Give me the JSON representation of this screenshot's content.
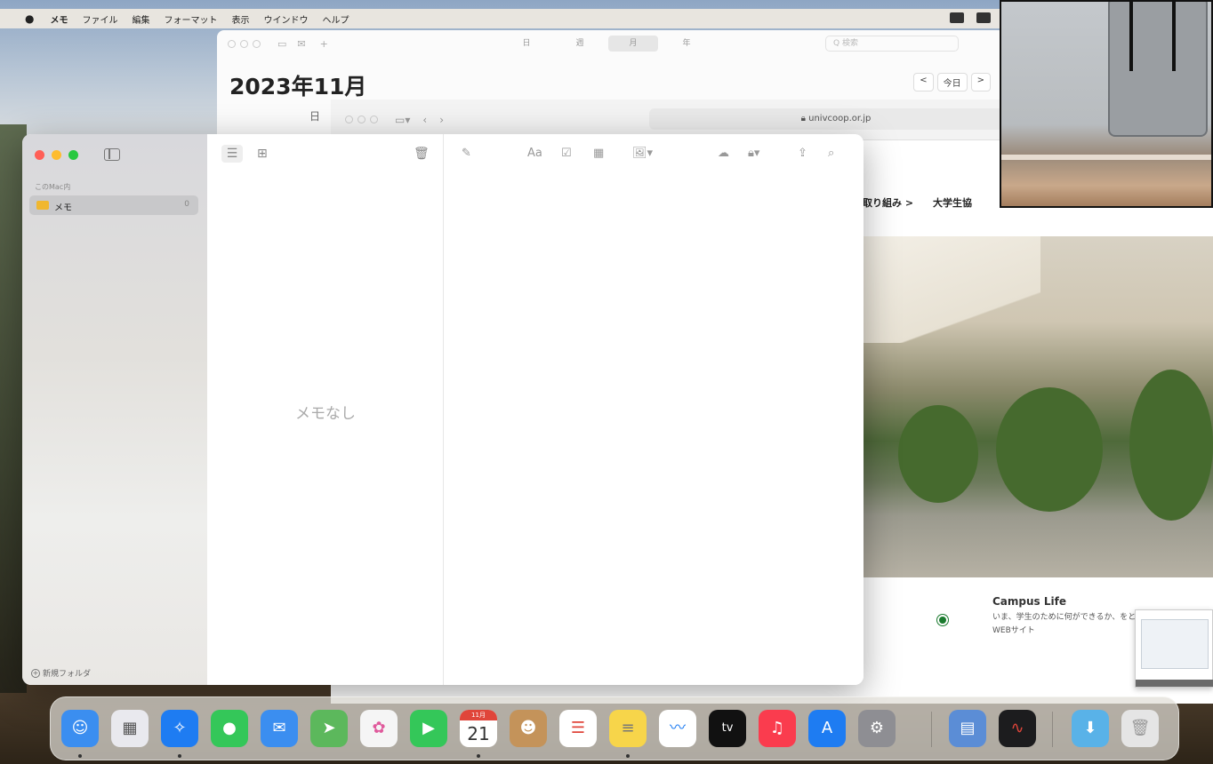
{
  "menubar": {
    "apple": "",
    "app_name": "メモ",
    "items": [
      "ファイル",
      "編集",
      "フォーマット",
      "表示",
      "ウインドウ",
      "ヘルプ"
    ]
  },
  "calendar_window": {
    "new_event": "+",
    "views": [
      "日",
      "週",
      "月",
      "年"
    ],
    "active_view": "月",
    "search_placeholder": "Q 検索",
    "title": "2023年11月",
    "today": "今日",
    "prev": "<",
    "next": ">",
    "day_label": "日"
  },
  "safari_window": {
    "url": "univcoop.or.jp",
    "nav_items": [
      "取り組み >",
      "大学生協"
    ],
    "campus_card": {
      "title": "Campus Life",
      "text": "いま、学生のために何ができるか、をともに考えるWEBサイト"
    }
  },
  "notes_window": {
    "sidebar": {
      "section": "このMac内",
      "folder_label": "メモ",
      "folder_count": "0",
      "new_folder": "新規フォルダ"
    },
    "list": {
      "empty_text": "メモなし"
    },
    "editor_toolbar": {
      "format": "Aa"
    }
  },
  "dock": {
    "items": [
      {
        "name": "finder-icon",
        "color": "#3b8ef0"
      },
      {
        "name": "launchpad-icon",
        "color": "#e9e9ee"
      },
      {
        "name": "safari-icon",
        "color": "#1e7cf2"
      },
      {
        "name": "messages-icon",
        "color": "#34c759"
      },
      {
        "name": "mail-icon",
        "color": "#3b8ef0"
      },
      {
        "name": "maps-icon",
        "color": "#5cb85c"
      },
      {
        "name": "photos-icon",
        "color": "#f5f5f5"
      },
      {
        "name": "facetime-icon",
        "color": "#34c759"
      },
      {
        "name": "calendar-icon",
        "color": "#ffffff"
      },
      {
        "name": "contacts-icon",
        "color": "#c4935a"
      },
      {
        "name": "reminders-icon",
        "color": "#ffffff"
      },
      {
        "name": "notes-icon",
        "color": "#f7d54a"
      },
      {
        "name": "freeform-icon",
        "color": "#ffffff"
      },
      {
        "name": "appletv-icon",
        "color": "#111111"
      },
      {
        "name": "music-icon",
        "color": "#fa3c4e"
      },
      {
        "name": "appstore-icon",
        "color": "#1e7cf2"
      },
      {
        "name": "settings-icon",
        "color": "#8e8e93"
      },
      {
        "name": "preview-icon",
        "color": "#5b8dd6"
      },
      {
        "name": "voicememos-icon",
        "color": "#1c1c1e"
      },
      {
        "name": "downloads-folder-icon",
        "color": "#59b2e8"
      },
      {
        "name": "trash-icon",
        "color": "#e5e5e5"
      }
    ],
    "calendar_month": "11月",
    "calendar_day": "21",
    "appletv_label": "tv"
  }
}
